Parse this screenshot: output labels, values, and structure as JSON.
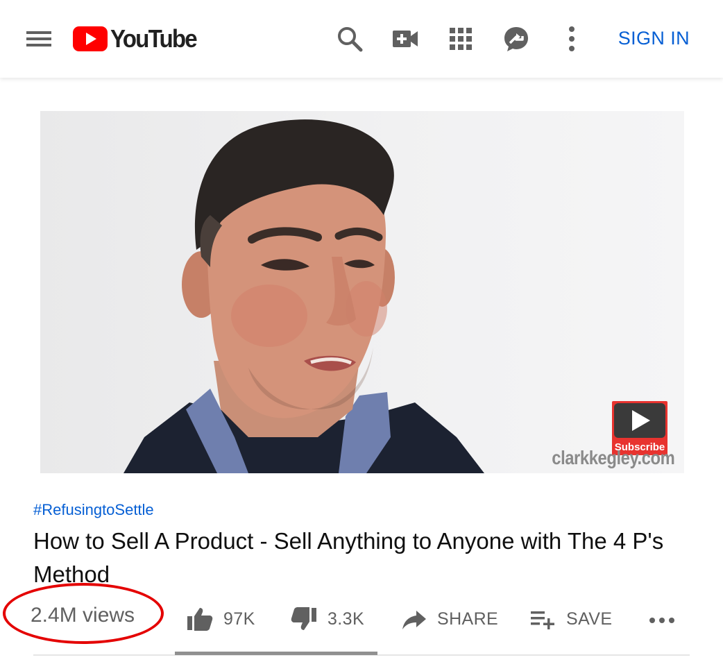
{
  "header": {
    "logo_text": "YouTube",
    "sign_in_label": "SIGN IN",
    "icons": [
      "menu-icon",
      "youtube-logo-icon",
      "search-icon",
      "create-video-icon",
      "apps-grid-icon",
      "messages-icon",
      "more-vert-icon"
    ]
  },
  "video": {
    "watermark": "clarkkegley.com",
    "subscribe_label": "Subscribe"
  },
  "info": {
    "hashtag": "#RefusingtoSettle",
    "title": "How to Sell A Product - Sell Anything to Anyone with The 4 P's Method",
    "views": "2.4M views"
  },
  "actions": {
    "like_count": "97K",
    "dislike_count": "3.3K",
    "share_label": "SHARE",
    "save_label": "SAVE"
  },
  "colors": {
    "brand_red": "#ff0000",
    "link_blue": "#065fd4",
    "annotation_red": "#e40000",
    "secondary_text": "#606060"
  }
}
